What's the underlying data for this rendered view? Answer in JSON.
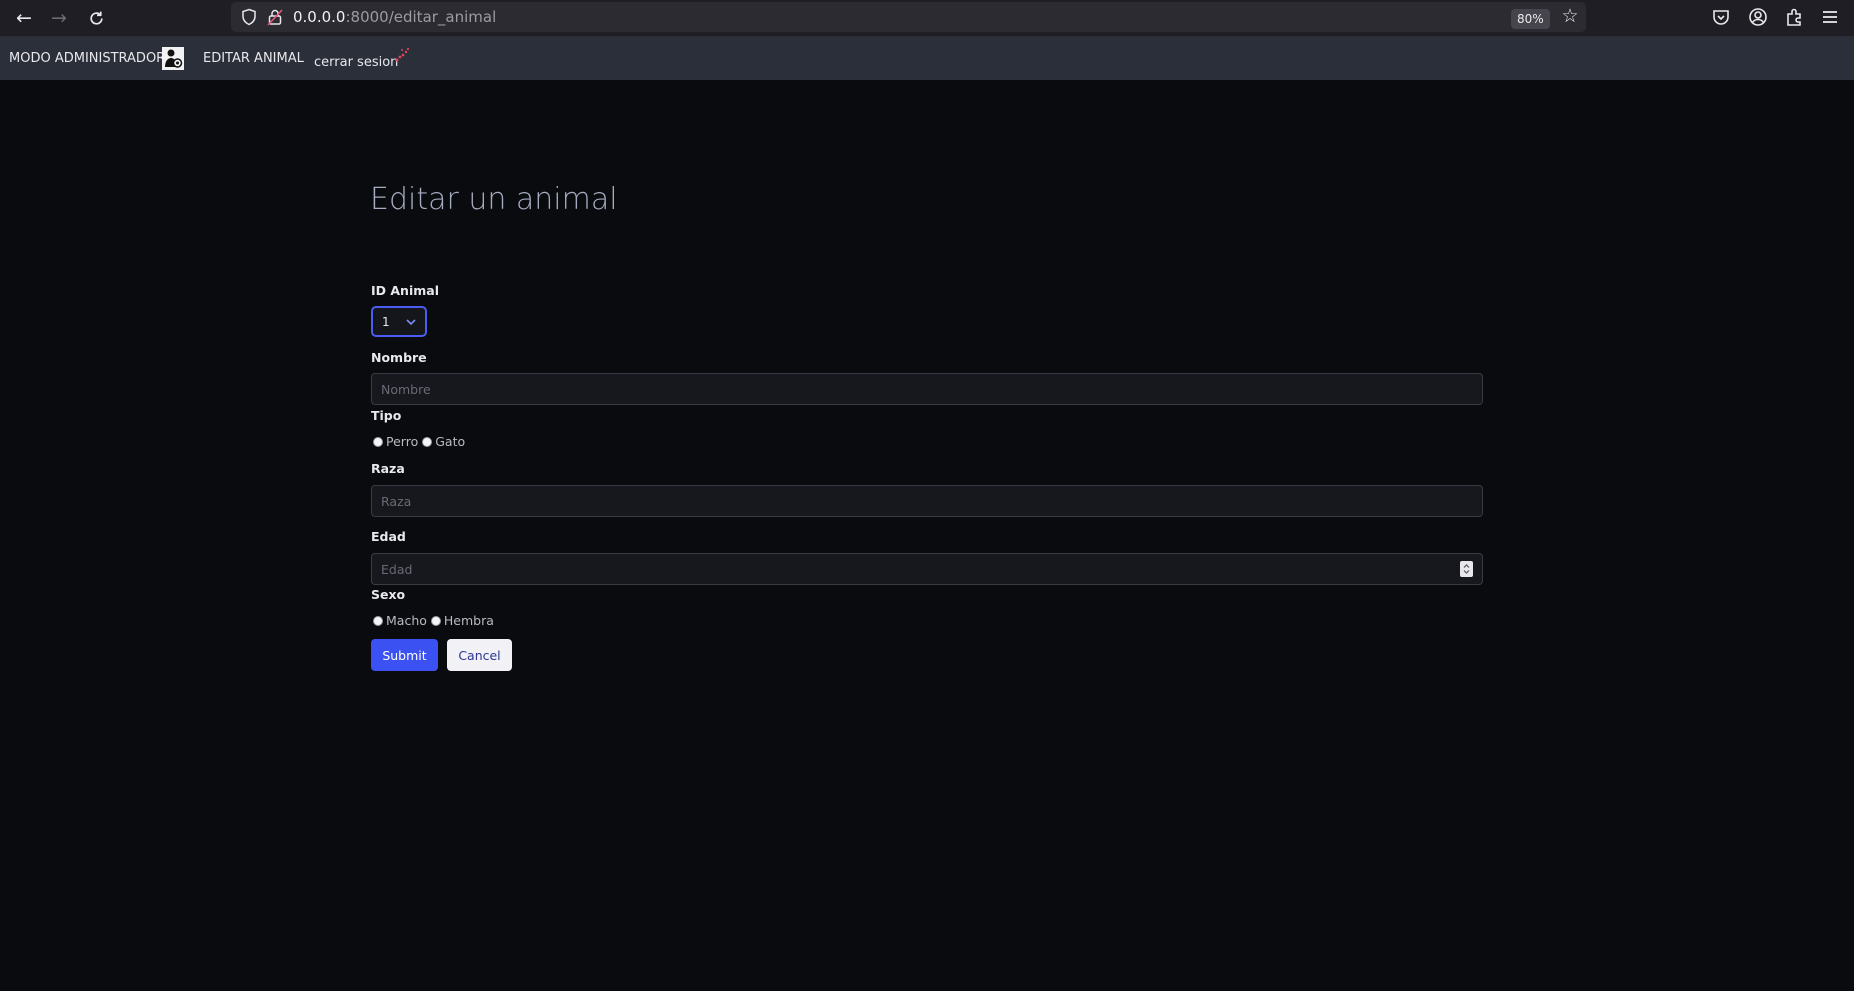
{
  "browser": {
    "url_host": "0.0.0.0",
    "url_path": ":8000/editar_animal",
    "zoom": "80%"
  },
  "navbar": {
    "brand": "MODO ADMINISTRADOR",
    "edit_link": "EDITAR ANIMAL",
    "logout": "cerrar sesion"
  },
  "form": {
    "title": "Editar un animal",
    "id_label": "ID Animal",
    "id_value": "1",
    "nombre_label": "Nombre",
    "nombre_placeholder": "Nombre",
    "tipo_label": "Tipo",
    "tipo_options": [
      "Perro",
      "Gato"
    ],
    "raza_label": "Raza",
    "raza_placeholder": "Raza",
    "edad_label": "Edad",
    "edad_placeholder": "Edad",
    "sexo_label": "Sexo",
    "sexo_options": [
      "Macho",
      "Hembra"
    ],
    "submit": "Submit",
    "cancel": "Cancel"
  },
  "colors": {
    "background": "#0a0b0e",
    "navbar": "#2b2f3a",
    "accent": "#3b51f2"
  }
}
